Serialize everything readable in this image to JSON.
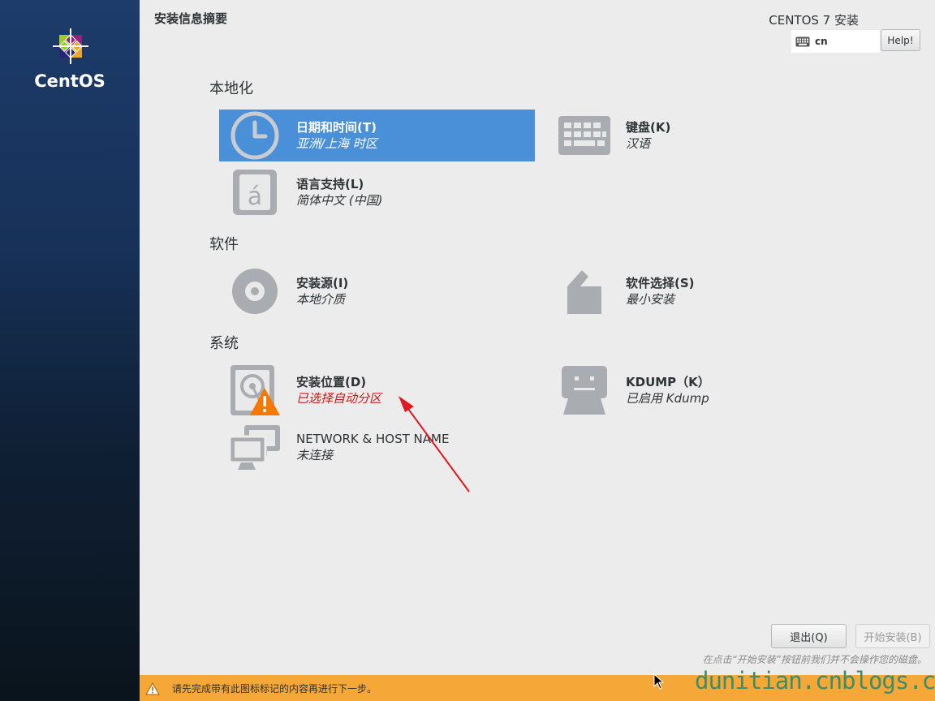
{
  "sidebar": {
    "brand": "CentOS"
  },
  "header": {
    "page_title": "安装信息摘要",
    "product_title": "CENTOS 7 安装",
    "keyboard_layout": "cn",
    "help_label": "Help!"
  },
  "categories": {
    "localization": {
      "title": "本地化",
      "spokes": {
        "datetime": {
          "name": "日期和时间(T)",
          "status": "亚洲/上海 时区",
          "icon": "clock-icon",
          "selected": true
        },
        "keyboard": {
          "name": "键盘(K)",
          "status": "汉语",
          "icon": "keyboard-icon"
        },
        "language": {
          "name": "语言支持(L)",
          "status": "简体中文 (中国)",
          "icon": "language-icon"
        }
      }
    },
    "software": {
      "title": "软件",
      "spokes": {
        "source": {
          "name": "安装源(I)",
          "status": "本地介质",
          "icon": "disc-icon"
        },
        "selection": {
          "name": "软件选择(S)",
          "status": "最小安装",
          "icon": "package-icon"
        }
      }
    },
    "system": {
      "title": "系统",
      "spokes": {
        "destination": {
          "name": "安装位置(D)",
          "status": "已选择自动分区",
          "icon": "harddisk-warning-icon",
          "warning": true
        },
        "kdump": {
          "name": "KDUMP（K）",
          "status": "已启用 Kdump",
          "icon": "kdump-icon"
        },
        "network": {
          "name": "NETWORK & HOST NAME",
          "status": "未连接",
          "icon": "network-icon"
        }
      }
    }
  },
  "footer": {
    "quit_label": "退出(Q)",
    "begin_label": "开始安装(B)",
    "note": "在点击“开始安装”按钮前我们并不会操作您的磁盘。",
    "warning_text": "请先完成带有此图标标记的内容再进行下一步。",
    "watermark": "dunitian.cnblogs.com"
  },
  "colors": {
    "selected": "#4a90d9",
    "warning_bar": "#f5a737",
    "warning_text": "#d01414",
    "sidebar_top": "#1d3c6b",
    "watermark": "#3c8e6a"
  }
}
